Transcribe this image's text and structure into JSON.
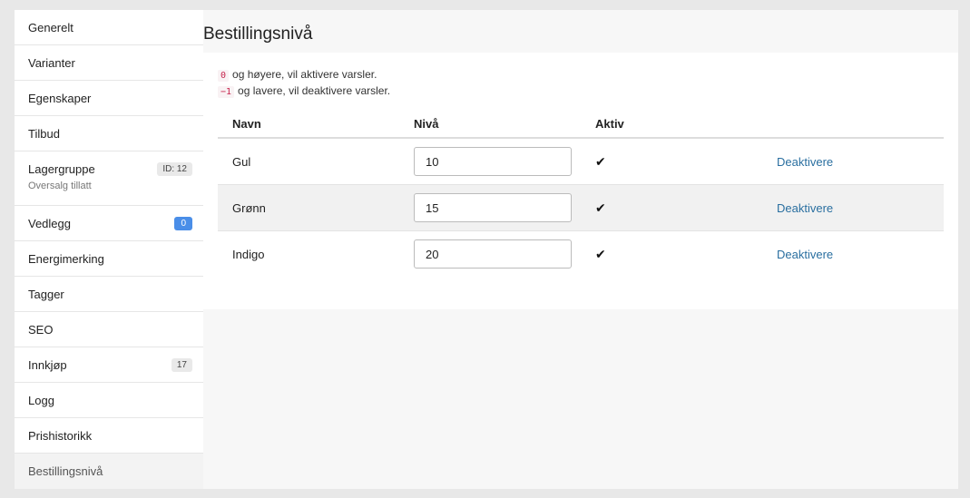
{
  "sidebar": {
    "items": [
      {
        "label": "Generelt"
      },
      {
        "label": "Varianter"
      },
      {
        "label": "Egenskaper"
      },
      {
        "label": "Tilbud"
      },
      {
        "label": "Lagergruppe",
        "badge": "ID: 12",
        "sub": "Oversalg tillatt"
      },
      {
        "label": "Vedlegg",
        "badge": "0"
      },
      {
        "label": "Energimerking"
      },
      {
        "label": "Tagger"
      },
      {
        "label": "SEO"
      },
      {
        "label": "Innkjøp",
        "badge": "17"
      },
      {
        "label": "Logg"
      },
      {
        "label": "Prishistorikk"
      },
      {
        "label": "Bestillingsnivå"
      }
    ]
  },
  "page": {
    "title": "Bestillingsnivå",
    "hint1_code": "0",
    "hint1_text": "og høyere, vil aktivere varsler.",
    "hint2_code": "−1",
    "hint2_text": "og lavere, vil deaktivere varsler."
  },
  "table": {
    "headers": {
      "name": "Navn",
      "level": "Nivå",
      "active": "Aktiv"
    },
    "rows": [
      {
        "name": "Gul",
        "level": "10",
        "action": "Deaktivere"
      },
      {
        "name": "Grønn",
        "level": "15",
        "action": "Deaktivere"
      },
      {
        "name": "Indigo",
        "level": "20",
        "action": "Deaktivere"
      }
    ]
  },
  "colors": {
    "accent_badge": "#4a8ee8",
    "link": "#2a6fa0",
    "code": "#c7254e"
  },
  "icons": {
    "active": "checkmark-icon"
  }
}
